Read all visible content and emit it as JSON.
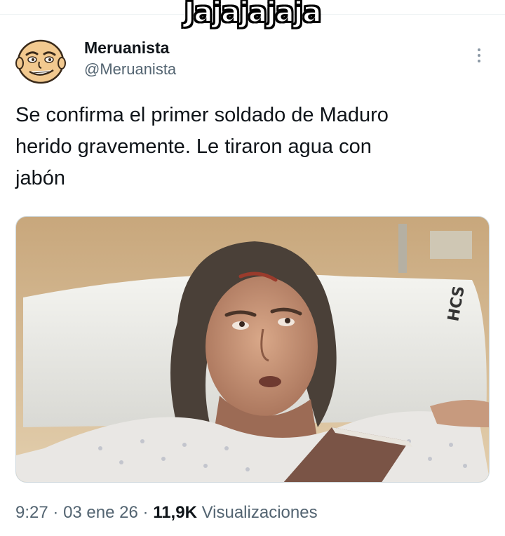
{
  "overlay_caption": "Jajajajaja",
  "tweet": {
    "author": {
      "display_name": "Meruanista",
      "handle": "@Meruanista",
      "avatar_icon": "cartoon-bald-man-avatar"
    },
    "more_icon": "vertical-ellipsis-icon",
    "text_lines": [
      "Se confirma el primer soldado de Maduro",
      "herido gravemente. Le tiraron agua con",
      "jabón"
    ],
    "media": {
      "kind": "photo",
      "subject": "hospital-bed-photo"
    },
    "meta": {
      "time": "9:27",
      "separator": "·",
      "date": "03 ene 26",
      "views_count": "11,9K",
      "views_label": "Visualizaciones"
    }
  },
  "colors": {
    "text_primary": "#0f1419",
    "text_secondary": "#536471",
    "divider": "#eff3f4",
    "background": "#ffffff"
  }
}
